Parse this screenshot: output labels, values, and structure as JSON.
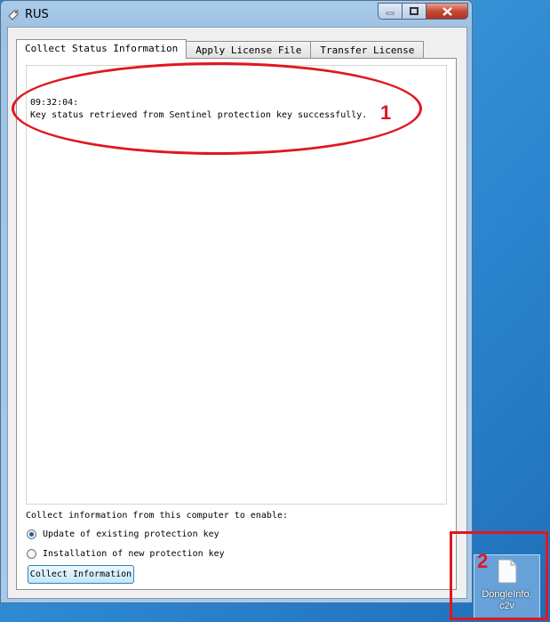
{
  "window": {
    "title": "RUS"
  },
  "tabs": [
    {
      "label": "Collect Status Information",
      "active": true
    },
    {
      "label": "Apply License File",
      "active": false
    },
    {
      "label": "Transfer License",
      "active": false
    }
  ],
  "log": {
    "lines": [
      "09:32:04:",
      "Key status retrieved from Sentinel protection key successfully."
    ]
  },
  "collect": {
    "label": "Collect information from this computer to enable:",
    "options": [
      {
        "label": "Update of existing protection key",
        "selected": true
      },
      {
        "label": "Installation of new protection key",
        "selected": false
      }
    ],
    "button_label": "Collect Information"
  },
  "annotations": {
    "one": "1",
    "two": "2"
  },
  "desktop_file": {
    "name_line1": "DongleInfo.",
    "name_line2": "c2v"
  },
  "colors": {
    "annotation": "#e0171f",
    "accent": "#1f5fa8"
  },
  "icons": {
    "app": "key-tag-icon",
    "file": "document-icon"
  }
}
